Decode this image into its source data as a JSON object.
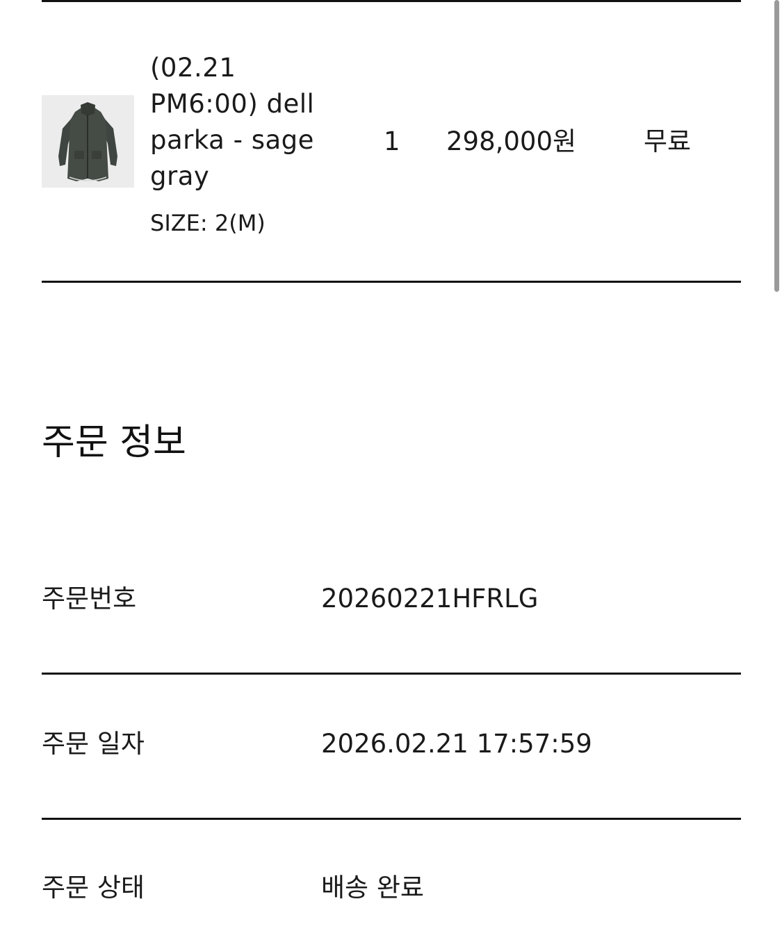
{
  "order_item": {
    "image_icon": "parka-product-photo",
    "name": "(02.21 PM6:00) dell parka - sage gray",
    "option": "SIZE: 2(M)",
    "quantity": "1",
    "price": "298,000원",
    "shipping": "무료"
  },
  "order_info": {
    "title": "주문 정보",
    "rows": [
      {
        "label": "주문번호",
        "value": "20260221HFRLG"
      },
      {
        "label": "주문 일자",
        "value": "2026.02.21 17:57:59"
      },
      {
        "label": "주문 상태",
        "value": "배송 완료"
      }
    ]
  },
  "colors": {
    "text": "#111111",
    "divider": "#111111",
    "background": "#ffffff",
    "scrollbar": "#9a9a9a"
  }
}
